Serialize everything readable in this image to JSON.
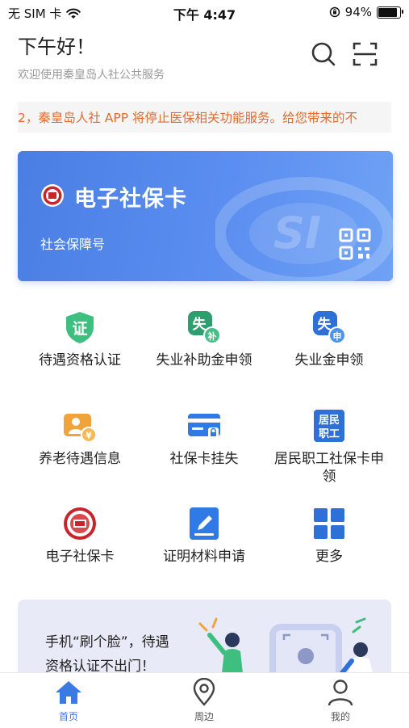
{
  "status_bar": {
    "carrier": "无 SIM 卡",
    "time": "下午 4:47",
    "battery": "94%",
    "battery_level": 0.94
  },
  "header": {
    "greeting": "下午好！",
    "subtitle": "欢迎使用秦皇岛人社公共服务"
  },
  "notice": {
    "text": "2，秦皇岛人社 APP 将停止医保相关功能服务。给您带来的不"
  },
  "card": {
    "title": "电子社保卡",
    "subtitle": "社会保障号"
  },
  "grid": [
    {
      "label": "待遇资格认证",
      "icon": "certificate-shield-icon"
    },
    {
      "label": "失业补助金申领",
      "icon": "unemployment-subsidy-icon"
    },
    {
      "label": "失业金申领",
      "icon": "unemployment-apply-icon"
    },
    {
      "label": "养老待遇信息",
      "icon": "pension-info-icon"
    },
    {
      "label": "社保卡挂失",
      "icon": "card-loss-report-icon"
    },
    {
      "label": "居民职工社保卡申领",
      "icon": "resident-card-apply-icon"
    },
    {
      "label": "电子社保卡",
      "icon": "social-security-emblem-icon"
    },
    {
      "label": "证明材料申请",
      "icon": "document-edit-icon"
    },
    {
      "label": "更多",
      "icon": "grid-more-icon"
    }
  ],
  "grid_icon_text": {
    "cert": "证",
    "unemp": "失",
    "sub_bu": "补",
    "sub_shen": "申",
    "resident": "居民职工"
  },
  "banner": {
    "line1": "手机“刷个脸”，待遇",
    "line2": "资格认证不出门！"
  },
  "tabs": [
    {
      "label": "首页",
      "icon": "home-icon",
      "active": true
    },
    {
      "label": "周边",
      "icon": "location-pin-icon",
      "active": false
    },
    {
      "label": "我的",
      "icon": "user-icon",
      "active": false
    }
  ],
  "colors": {
    "accent": "#3b7ae3",
    "card": "#5b8ef0",
    "notice": "#e56a2b",
    "green": "#3fbf7f",
    "orange": "#f0a23b"
  }
}
